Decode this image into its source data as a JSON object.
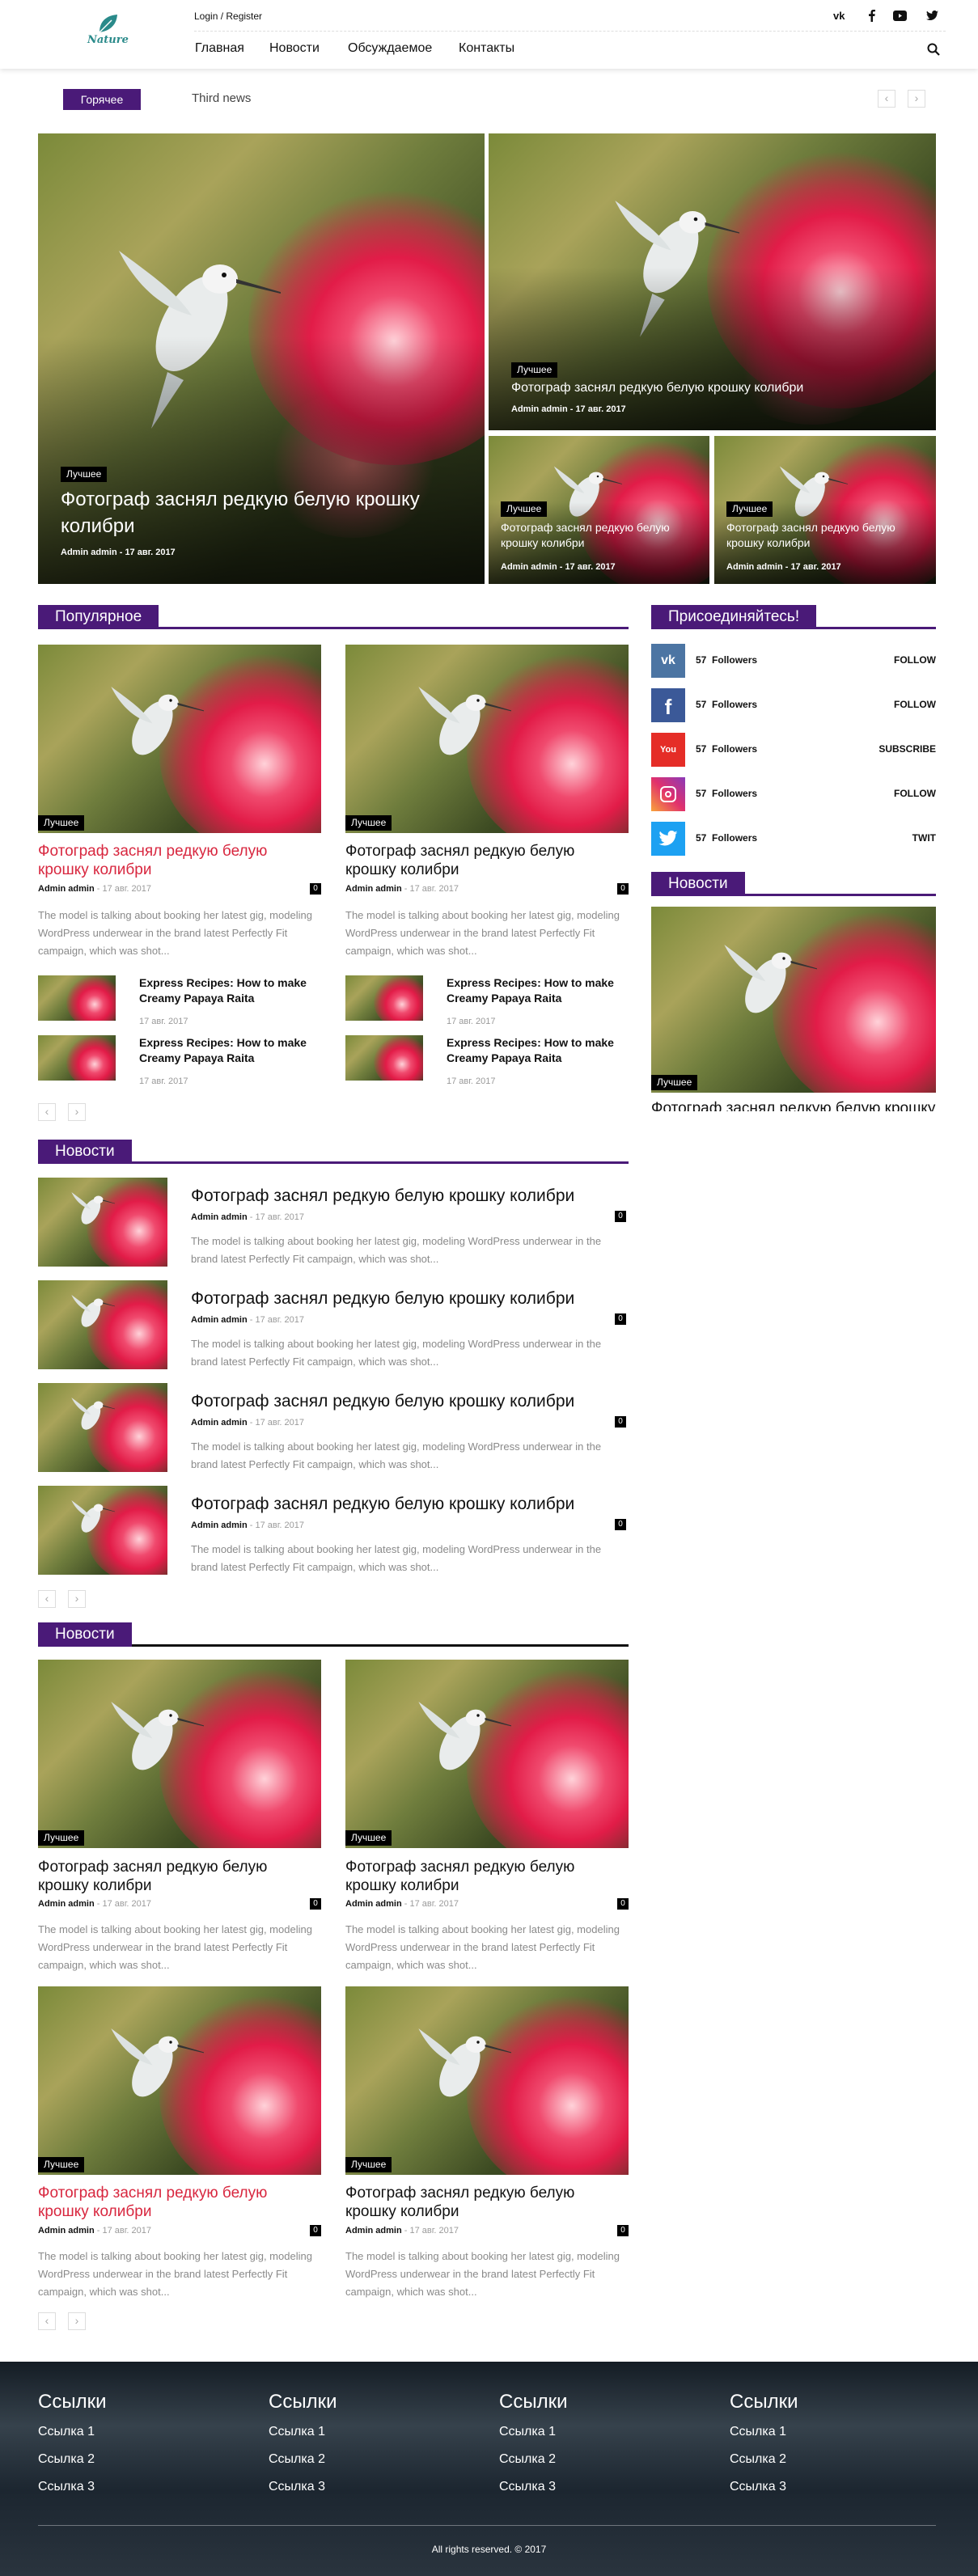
{
  "header": {
    "logo_text": "Nature",
    "login_label": "Login / Register",
    "nav": [
      "Главная",
      "Новости",
      "Обсуждаемое",
      "Контакты"
    ],
    "social_icons": [
      "vk-icon",
      "facebook-icon",
      "youtube-icon",
      "twitter-icon"
    ]
  },
  "ticker": {
    "label": "Горячее",
    "text": "Third news"
  },
  "featured": {
    "main": {
      "badge": "Лучшее",
      "title": "Фотограф заснял редкую белую крошку колибри",
      "meta": "Admin admin - 17 авг. 2017"
    },
    "top_right": {
      "badge": "Лучшее",
      "title": "Фотограф заснял редкую белую крошку колибри",
      "meta": "Admin admin - 17 авг. 2017"
    },
    "bottom_left": {
      "badge": "Лучшее",
      "title": "Фотограф заснял редкую белую крошку колибри",
      "meta": "Admin admin - 17 авг. 2017"
    },
    "bottom_right": {
      "badge": "Лучшее",
      "title": "Фотограф заснял редкую белую крошку колибри",
      "meta": "Admin admin - 17 авг. 2017"
    }
  },
  "popular": {
    "heading": "Популярное",
    "cards": [
      {
        "badge": "Лучшее",
        "title": "Фотограф заснял редкую белую крошку колибри",
        "author": "Admin admin",
        "date": " - 17 авг. 2017",
        "count": "0",
        "excerpt": "The model is talking about booking her latest gig, modeling WordPress underwear in the brand latest Perfectly Fit campaign, which was shot..."
      },
      {
        "badge": "Лучшее",
        "title": "Фотограф заснял редкую белую крошку колибри",
        "author": "Admin admin",
        "date": " - 17 авг. 2017",
        "count": "0",
        "excerpt": "The model is talking about booking her latest gig, modeling WordPress underwear in the brand latest Perfectly Fit campaign, which was shot..."
      }
    ],
    "small": [
      {
        "title": "Express Recipes: How to make Creamy Papaya Raita",
        "date": "17 авг. 2017"
      },
      {
        "title": "Express Recipes: How to make Creamy Papaya Raita",
        "date": "17 авг. 2017"
      },
      {
        "title": "Express Recipes: How to make Creamy Papaya Raita",
        "date": "17 авг. 2017"
      },
      {
        "title": "Express Recipes: How to make Creamy Papaya Raita",
        "date": "17 авг. 2017"
      }
    ]
  },
  "sidebar": {
    "join_heading": "Присоединяйтесь!",
    "social": [
      {
        "icon": "vk-icon",
        "count": "57",
        "label": "Followers",
        "action": "FOLLOW",
        "color": "#4c75a3"
      },
      {
        "icon": "facebook-icon",
        "count": "57",
        "label": "Followers",
        "action": "FOLLOW",
        "color": "#3b5998"
      },
      {
        "icon": "youtube-icon",
        "count": "57",
        "label": "Followers",
        "action": "SUBSCRIBE",
        "color": "#e52d27"
      },
      {
        "icon": "instagram-icon",
        "count": "57",
        "label": "Followers",
        "action": "FOLLOW",
        "color": "#c13584"
      },
      {
        "icon": "twitter-icon",
        "count": "57",
        "label": "Followers",
        "action": "TWIT",
        "color": "#1da1f2"
      }
    ],
    "news_heading": "Новости",
    "news_badge": "Лучшее",
    "news_title": "Фотограф заснял редкую белую крошку колибри"
  },
  "news_list": {
    "heading": "Новости",
    "items": [
      {
        "title": "Фотограф заснял редкую белую крошку колибри",
        "author": "Admin admin",
        "date": " - 17 авг. 2017",
        "count": "0",
        "excerpt": "The model is talking about booking her latest gig, modeling WordPress underwear in the brand latest Perfectly Fit campaign, which was shot..."
      },
      {
        "title": "Фотограф заснял редкую белую крошку колибри",
        "author": "Admin admin",
        "date": " - 17 авг. 2017",
        "count": "0",
        "excerpt": "The model is talking about booking her latest gig, modeling WordPress underwear in the brand latest Perfectly Fit campaign, which was shot..."
      },
      {
        "title": "Фотограф заснял редкую белую крошку колибри",
        "author": "Admin admin",
        "date": " - 17 авг. 2017",
        "count": "0",
        "excerpt": "The model is talking about booking her latest gig, modeling WordPress underwear in the brand latest Perfectly Fit campaign, which was shot..."
      },
      {
        "title": "Фотограф заснял редкую белую крошку колибри",
        "author": "Admin admin",
        "date": " - 17 авг. 2017",
        "count": "0",
        "excerpt": "The model is talking about booking her latest gig, modeling WordPress underwear in the brand latest Perfectly Fit campaign, which was shot..."
      }
    ]
  },
  "news_grid": {
    "heading": "Новости",
    "cards": [
      {
        "badge": "Лучшее",
        "title": "Фотограф заснял редкую белую крошку колибри",
        "author": "Admin admin",
        "date": " - 17 авг. 2017",
        "count": "0",
        "excerpt": "The model is talking about booking her latest gig, modeling WordPress underwear in the brand latest Perfectly Fit campaign, which was shot..."
      },
      {
        "badge": "Лучшее",
        "title": "Фотограф заснял редкую белую крошку колибри",
        "author": "Admin admin",
        "date": " - 17 авг. 2017",
        "count": "0",
        "excerpt": "The model is talking about booking her latest gig, modeling WordPress underwear in the brand latest Perfectly Fit campaign, which was shot..."
      },
      {
        "badge": "Лучшее",
        "title": "Фотограф заснял редкую белую крошку колибри",
        "author": "Admin admin",
        "date": " - 17 авг. 2017",
        "count": "0",
        "excerpt": "The model is talking about booking her latest gig, modeling WordPress underwear in the brand latest Perfectly Fit campaign, which was shot..."
      },
      {
        "badge": "Лучшее",
        "title": "Фотограф заснял редкую белую крошку колибри",
        "author": "Admin admin",
        "date": " - 17 авг. 2017",
        "count": "0",
        "excerpt": "The model is talking about booking her latest gig, modeling WordPress underwear in the brand latest Perfectly Fit campaign, which was shot..."
      }
    ]
  },
  "footer": {
    "columns": [
      {
        "heading": "Ссылки",
        "links": [
          "Ссылка 1",
          "Ссылка 2",
          "Ссылка 3"
        ]
      },
      {
        "heading": "Ссылки",
        "links": [
          "Ссылка 1",
          "Ссылка 2",
          "Ссылка 3"
        ]
      },
      {
        "heading": "Ссылки",
        "links": [
          "Ссылка 1",
          "Ссылка 2",
          "Ссылка 3"
        ]
      },
      {
        "heading": "Ссылки",
        "links": [
          "Ссылка 1",
          "Ссылка 2",
          "Ссылка 3"
        ]
      }
    ],
    "copyright": "All rights reserved. © 2017"
  },
  "colors": {
    "accent": "#4a1a78",
    "red_title": "#d8273f",
    "logo": "#2a8a8a"
  }
}
